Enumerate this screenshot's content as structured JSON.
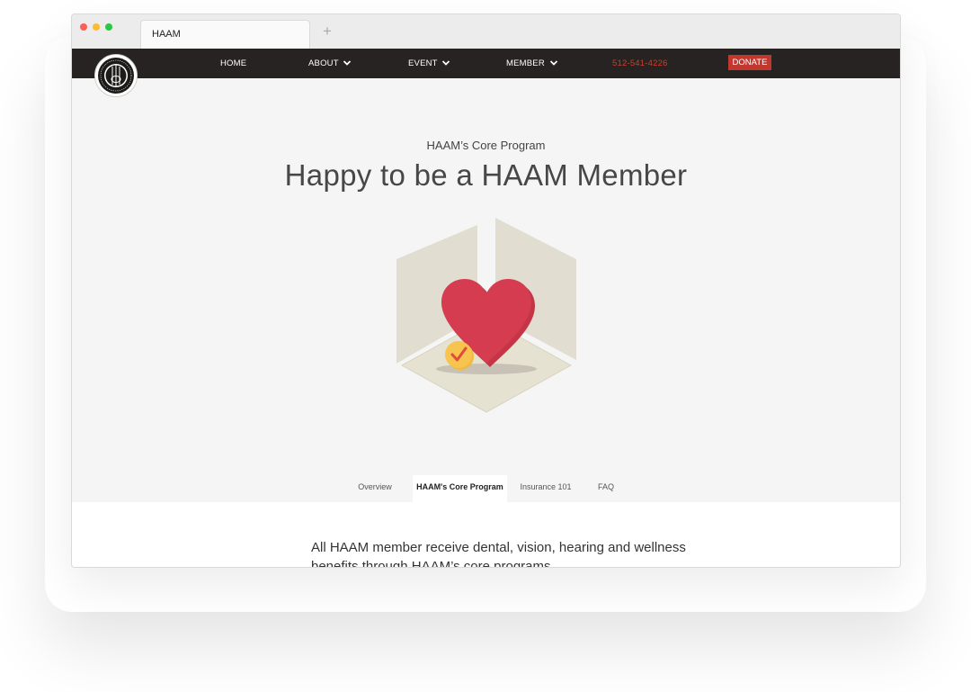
{
  "browser": {
    "tab_title": "HAAM",
    "new_tab_symbol": "+"
  },
  "nav": {
    "items": [
      {
        "label": "HOME",
        "has_dropdown": false
      },
      {
        "label": "ABOUT",
        "has_dropdown": true
      },
      {
        "label": "EVENT",
        "has_dropdown": true
      },
      {
        "label": "MEMBER",
        "has_dropdown": true
      }
    ],
    "phone": "512-541-4226",
    "donate_label": "DONATE",
    "icons": {
      "logo": "haam-guitar-seal-logo",
      "dropdown": "chevron-down-icon"
    }
  },
  "hero": {
    "kicker": "HAAM’s Core Program",
    "headline": "Happy to be a HAAM Member",
    "illustration": "heart-with-checkmark-in-open-box"
  },
  "subtabs": [
    {
      "label": "Overview",
      "active": false
    },
    {
      "label": "HAAM's Core Program",
      "active": true
    },
    {
      "label": "Insurance 101",
      "active": false
    },
    {
      "label": "FAQ",
      "active": false
    }
  ],
  "content": {
    "intro": "All HAAM member receive dental, vision, hearing and wellness benefits through HAAM’s core programs."
  },
  "colors": {
    "nav_bg": "#262322",
    "accent_red": "#c2382e",
    "phone_red": "#c8402f",
    "page_bg": "#f5f5f5",
    "heart": "#d53c50",
    "check_badge": "#f7c44f"
  }
}
